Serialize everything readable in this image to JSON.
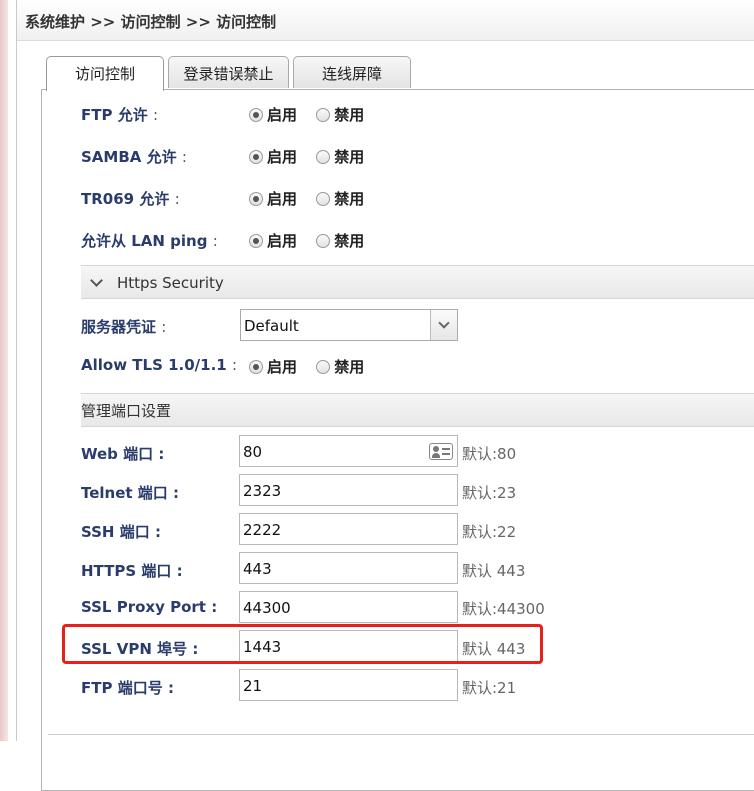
{
  "header": {
    "breadcrumb": "系统维护 >> 访问控制 >> 访问控制"
  },
  "tabs": [
    {
      "label": "访问控制",
      "active": true
    },
    {
      "label": "登录错误禁止",
      "active": false
    },
    {
      "label": "连线屏障",
      "active": false
    }
  ],
  "radio_rows": [
    {
      "label": "FTP 允许",
      "colon": ":",
      "enable": "启用",
      "disable": "禁用",
      "selected": "enable"
    },
    {
      "label": "SAMBA 允许",
      "colon": ":",
      "enable": "启用",
      "disable": "禁用",
      "selected": "enable"
    },
    {
      "label": "TR069 允许",
      "colon": ":",
      "enable": "启用",
      "disable": "禁用",
      "selected": "enable"
    },
    {
      "label": "允许从 LAN ping",
      "colon": ":",
      "enable": "启用",
      "disable": "禁用",
      "selected": "enable"
    }
  ],
  "https_section": {
    "title": "Https Security",
    "icon": "chevron-down-icon"
  },
  "server_cert": {
    "label": "服务器凭证",
    "colon": ":",
    "value": "Default"
  },
  "tls_row": {
    "label": "Allow TLS 1.0/1.1",
    "colon": ":",
    "enable": "启用",
    "disable": "禁用",
    "selected": "enable"
  },
  "ports_section": {
    "title": "管理端口设置"
  },
  "ports": [
    {
      "label": "Web 端口",
      "colon": ":",
      "value": "80",
      "default": "默认:80"
    },
    {
      "label": "Telnet 端口",
      "colon": ":",
      "value": "2323",
      "default": "默认:23"
    },
    {
      "label": "SSH 端口",
      "colon": ":",
      "value": "2222",
      "default": "默认:22"
    },
    {
      "label": "HTTPS 端口",
      "colon": ":",
      "value": "443",
      "default": "默认 443"
    },
    {
      "label": "SSL Proxy Port",
      "colon": ":",
      "value": "44300",
      "default": "默认:44300"
    },
    {
      "label": "SSL VPN 埠号",
      "colon": ":",
      "value": "1443",
      "default": "默认 443"
    },
    {
      "label": "FTP 端口号",
      "colon": ":",
      "value": "21",
      "default": "默认:21"
    }
  ],
  "colors": {
    "label": "#2a3c6b",
    "highlight": "#e8201c"
  }
}
